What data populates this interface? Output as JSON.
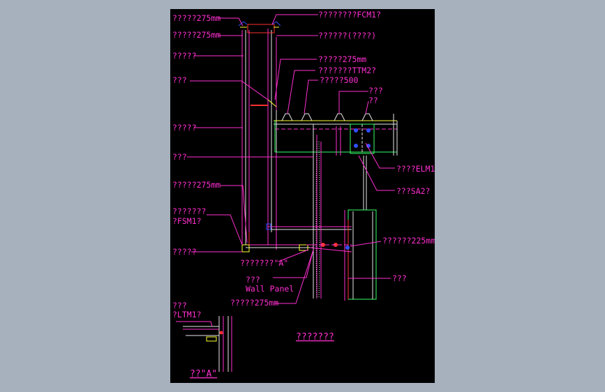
{
  "colors": {
    "background": "#a7b1bd",
    "sheet": "#000000",
    "label": "#ff2fd0",
    "steel_white": "#e8e8e8",
    "panel_green": "#33ff66",
    "accent_yellow": "#ffff33",
    "cyan": "#33ddff",
    "red": "#ff3030",
    "blue": "#3050ff"
  },
  "labels": {
    "l01": "?????275mm",
    "l02": "?????275mm",
    "l03": "?????",
    "l04": "???",
    "l05": "?????",
    "l06": "???",
    "l07": "?????275mm",
    "l08": "???????",
    "l09": "?FSM1?",
    "l10": "?????",
    "l11": "????????FCM1?",
    "l12": "??????(????)",
    "l13": "?????275mm",
    "l14": "???????TTM2?",
    "l15": "?????500",
    "l16": "???",
    "l17": "??",
    "l18": "????ELM1?",
    "l19": "???SA2?",
    "l20": "??????225mm",
    "l21": "???",
    "l22": "???????\"A\"",
    "l23": "???",
    "l24": "Wall Panel",
    "l25": "?????275mm",
    "l26": "???",
    "l27": "?LTM1?",
    "l28": "???????",
    "l29": "??\"A\""
  }
}
